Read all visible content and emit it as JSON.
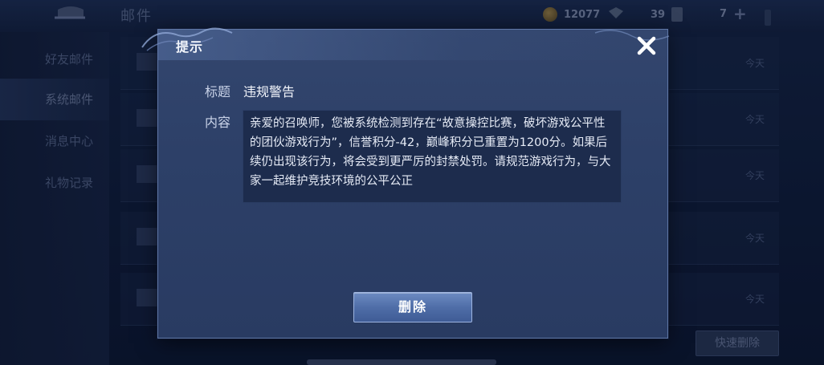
{
  "background": {
    "title": "邮件",
    "currencies": [
      {
        "icon": "coin-icon",
        "value": "12077"
      },
      {
        "icon": "gem-icon",
        "value": "39"
      },
      {
        "icon": "ticket-icon",
        "value": "7"
      }
    ],
    "sidebar": [
      {
        "label": "好友邮件",
        "active": false
      },
      {
        "label": "系统邮件",
        "active": true
      },
      {
        "label": "消息中心",
        "active": false
      },
      {
        "label": "礼物记录",
        "active": false
      }
    ],
    "mail_dates": [
      "今天",
      "今天",
      "今天",
      "今天",
      "今天"
    ],
    "quick_delete": "快速删除"
  },
  "dialog": {
    "title": "提示",
    "subject_label": "标题",
    "subject_value": "违规警告",
    "content_label": "内容",
    "content_text": "亲爱的召唤师，您被系统检测到存在“故意操控比赛，破坏游戏公平性的团伙游戏行为”，信誉积分-42，巅峰积分已重置为1200分。如果后续仍出现该行为，将会受到更严厉的封禁处罚。请规范游戏行为，与大家一起维护竞技环境的公平公正",
    "delete_label": "删除"
  },
  "colors": {
    "dialog_bg": "#2d4068",
    "dialog_border": "#5f77a6",
    "button_accent": "#4f6ea8"
  }
}
